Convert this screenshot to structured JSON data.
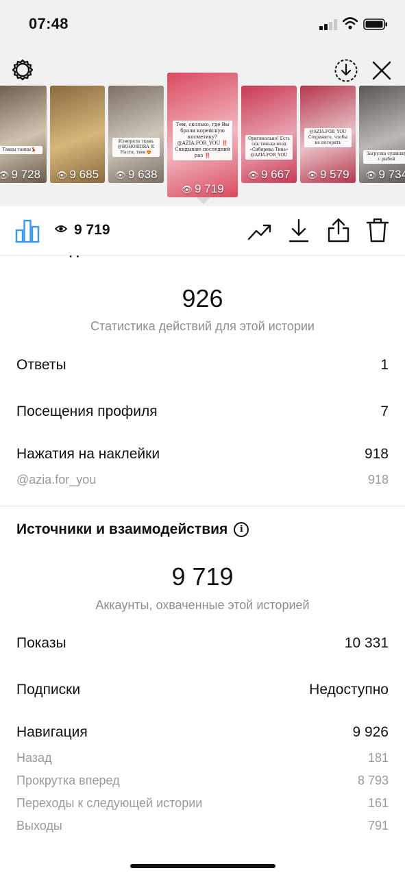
{
  "status": {
    "time": "07:48"
  },
  "stories": [
    {
      "views": "9 728",
      "colors": [
        "#6b5a49",
        "#cfc3b0"
      ],
      "sticker": "Танцы танцы💃"
    },
    {
      "views": "9 685",
      "colors": [
        "#8b6a3f",
        "#d6b67a"
      ],
      "sticker": ""
    },
    {
      "views": "9 638",
      "colors": [
        "#7a7066",
        "#d0c7bb"
      ],
      "sticker": "Измеряла ткань @BOHOSIDRA_K Настя, тюм 😍"
    },
    {
      "views": "9 719",
      "colors": [
        "#d94a5f",
        "#f3b7c0"
      ],
      "sticker": "Тем, сколько, где Вы брали корейскую косметику? @AZIA.FOR_YOU ‼️Скидываю последний раз ‼️"
    },
    {
      "views": "9 667",
      "colors": [
        "#c93a55",
        "#e8a2b0"
      ],
      "sticker": "Оригинально! Есть сок тинька вход «Сибирика Тина» @AZIA.FOR_YOU"
    },
    {
      "views": "9 579",
      "colors": [
        "#b7364e",
        "#e7c1c6"
      ],
      "sticker": "@AZIA.FOR_YOU Сохраните, чтобы не потерять"
    },
    {
      "views": "9 734",
      "colors": [
        "#5a5654",
        "#bdb8b3"
      ],
      "sticker": "Загрузка сушилку с рыбой"
    }
  ],
  "toolbar": {
    "views": "9 719"
  },
  "interactions": {
    "heading": "Взаимодействия",
    "total": "926",
    "caption": "Статистика действий для этой истории",
    "rows": [
      {
        "label": "Ответы",
        "value": "1"
      },
      {
        "label": "Посещения профиля",
        "value": "7"
      },
      {
        "label": "Нажатия на наклейки",
        "value": "918"
      }
    ],
    "sticker_row": {
      "label": "@azia.for_you",
      "value": "918"
    }
  },
  "discovery": {
    "heading": "Источники и взаимодействия",
    "total": "9 719",
    "caption": "Аккаунты, охваченные этой историей",
    "rows": [
      {
        "label": "Показы",
        "value": "10 331"
      },
      {
        "label": "Подписки",
        "value": "Недоступно"
      },
      {
        "label": "Навигация",
        "value": "9 926"
      }
    ],
    "navigation": [
      {
        "label": "Назад",
        "value": "181"
      },
      {
        "label": "Прокрутка вперед",
        "value": "8 793"
      },
      {
        "label": "Переходы к следующей истории",
        "value": "161"
      },
      {
        "label": "Выходы",
        "value": "791"
      }
    ]
  },
  "icons": [
    "settings-gear-icon",
    "download-circle-icon",
    "close-icon",
    "bar-chart-icon",
    "eye-icon",
    "trending-icon",
    "download-icon",
    "share-icon",
    "trash-icon",
    "info-icon"
  ],
  "colors": {
    "accent_blue": "#3897f0",
    "muted": "#8e8e8e",
    "background": "#f1f1f1"
  }
}
